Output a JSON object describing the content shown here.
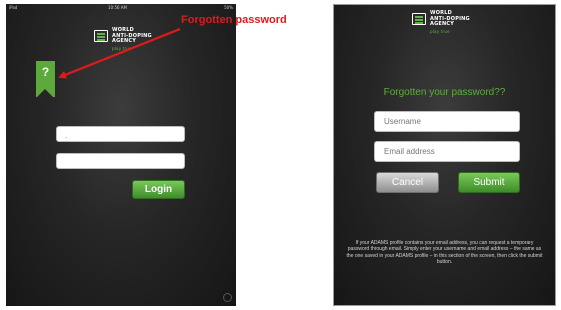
{
  "left": {
    "status": {
      "carrier": "iPad",
      "time": "10:56 AM",
      "battery": "50%"
    },
    "logo": {
      "lines": [
        "WORLD",
        "ANTI-DOPING",
        "AGENCY"
      ],
      "tagline": "play true"
    },
    "bookmark": {
      "label": "?"
    },
    "fields": [
      {
        "value": ".",
        "placeholder": ""
      },
      {
        "value": "",
        "placeholder": ""
      }
    ],
    "login_label": "Login"
  },
  "annotation": {
    "text": "Forgotten password",
    "color": "#e01a1a"
  },
  "right": {
    "logo": {
      "lines": [
        "WORLD",
        "ANTI-DOPING",
        "AGENCY"
      ],
      "tagline": "play true"
    },
    "title": "Forgotten your password??",
    "username_placeholder": "Username",
    "email_placeholder": "Email address",
    "cancel_label": "Cancel",
    "submit_label": "Submit",
    "help_text": "If your ADAMS profile contains your email address, you can request a temporary password through email. Simply enter your username and email address – the same as the one saved in your ADAMS profile – in this section of the screen, then click the submit button."
  },
  "colors": {
    "accent_green": "#5caa3b",
    "annotation_red": "#e01a1a",
    "background": "#262626"
  },
  "icons": [
    "question-bookmark-icon",
    "wada-logo-icon",
    "red-arrow-icon",
    "settings-corner-icon"
  ]
}
